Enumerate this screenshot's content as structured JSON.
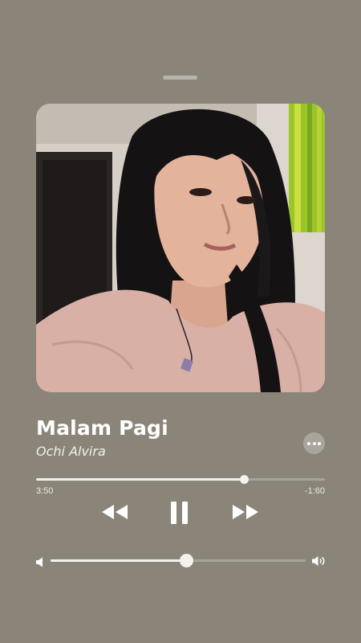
{
  "track": {
    "title": "Malam Pagi",
    "artist": "Ochi Alvira",
    "artwork_icon": "album-artwork-photo"
  },
  "playback": {
    "elapsed": "3:50",
    "remaining": "-1:60",
    "progress": 0.72,
    "state": "playing"
  },
  "controls": {
    "more_icon": "ellipsis-icon",
    "rewind_icon": "rewind-icon",
    "pause_icon": "pause-icon",
    "forward_icon": "fast-forward-icon"
  },
  "volume": {
    "level": 0.53,
    "low_icon": "speaker-low-icon",
    "high_icon": "speaker-high-icon"
  },
  "colors": {
    "background": "#8b8579",
    "accent": "#f4f2ee",
    "track": "#a8a399"
  }
}
